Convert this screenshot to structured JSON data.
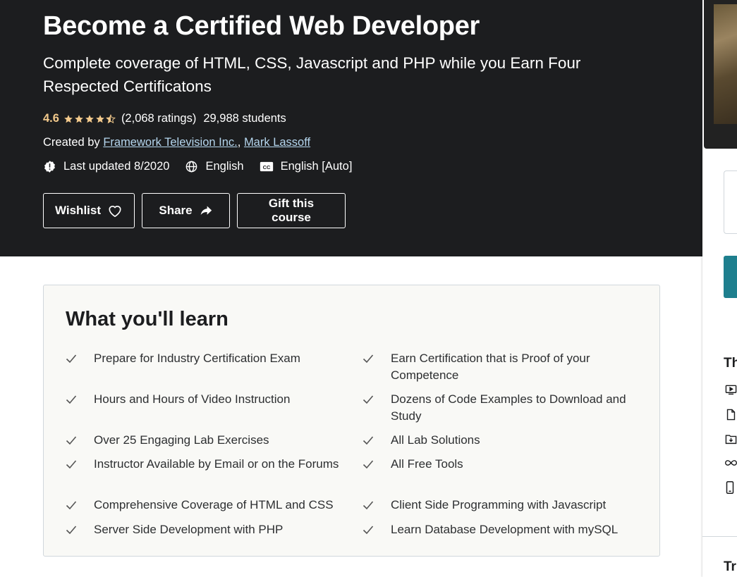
{
  "course": {
    "title": "Become a Certified Web Developer",
    "subtitle": "Complete coverage of HTML, CSS, Javascript and PHP while you Earn Four Respected Certificatons",
    "rating": "4.6",
    "rating_value": 4.6,
    "ratings_count": "(2,068 ratings)",
    "students": "29,988 students",
    "created_by_label": "Created by",
    "instructors": [
      "Framework Television Inc.",
      "Mark Lassoff"
    ],
    "instructor_separator": ",",
    "last_updated": "Last updated 8/2020",
    "language": "English",
    "captions": "English [Auto]"
  },
  "actions": {
    "wishlist": "Wishlist",
    "share": "Share",
    "gift": "Gift this course"
  },
  "learn": {
    "title": "What you'll learn",
    "items": [
      "Prepare for Industry Certification Exam",
      "Earn Certification that is Proof of your Competence",
      "Hours and Hours of Video Instruction",
      "Dozens of Code Examples to Download and Study",
      "Over 25 Engaging Lab Exercises",
      "All Lab Solutions",
      "Instructor Available by Email or on the Forums",
      "All Free Tools",
      "Comprehensive Coverage of HTML and CSS",
      "Client Side Programming with Javascript",
      "Server Side Development with PHP",
      "Learn Database Development with mySQL"
    ]
  },
  "sidebar": {
    "heading_partial": "Th",
    "heading2_partial": "Tr",
    "icons": [
      "video-icon",
      "file-icon",
      "download-icon",
      "infinity-icon",
      "mobile-icon"
    ]
  },
  "colors": {
    "hero_bg": "#1c1d1f",
    "rating_accent": "#f3ca8c",
    "link": "#b5d6ee",
    "side_button": "#1e7f8e"
  }
}
